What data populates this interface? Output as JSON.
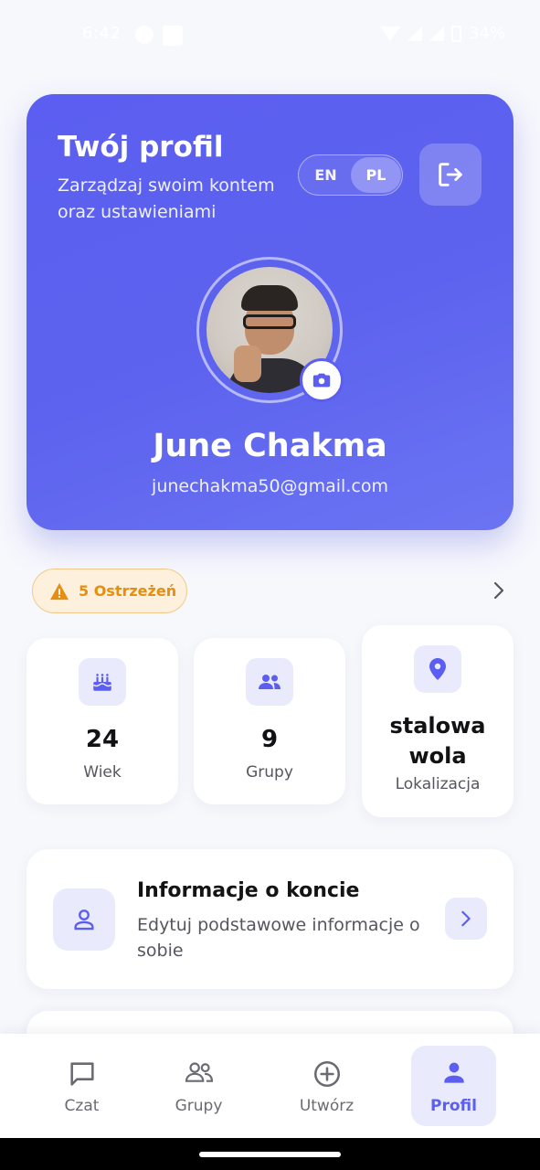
{
  "status_bar": {
    "time": "6:42",
    "battery": "34%"
  },
  "header": {
    "title": "Twój profil",
    "subtitle": "Zarządzaj swoim kontem oraz ustawieniami",
    "lang_en": "EN",
    "lang_pl": "PL",
    "active_lang": "PL",
    "logout_icon": "logout-icon"
  },
  "user": {
    "name": "June Chakma",
    "email": "junechakma50@gmail.com"
  },
  "warnings": {
    "label": "5 Ostrzeżeń"
  },
  "stats": [
    {
      "value": "24",
      "label": "Wiek",
      "icon": "cake-icon"
    },
    {
      "value": "9",
      "label": "Grupy",
      "icon": "group-icon"
    },
    {
      "value": "stalowa wola",
      "label": "Lokalizacja",
      "icon": "location-pin-icon"
    }
  ],
  "account": {
    "title": "Informacje o koncie",
    "description": "Edytuj podstawowe informacje o sobie"
  },
  "nav": [
    {
      "label": "Czat",
      "icon": "chat-icon"
    },
    {
      "label": "Grupy",
      "icon": "group-icon"
    },
    {
      "label": "Utwórz",
      "icon": "add-circle-icon"
    },
    {
      "label": "Profil",
      "icon": "person-icon"
    }
  ],
  "colors": {
    "accent": "#5b5ef0",
    "accent_light": "#e9ebfd",
    "warning": "#e58e12",
    "warning_bg": "#fdf0dc",
    "background": "#f7f8fc"
  }
}
